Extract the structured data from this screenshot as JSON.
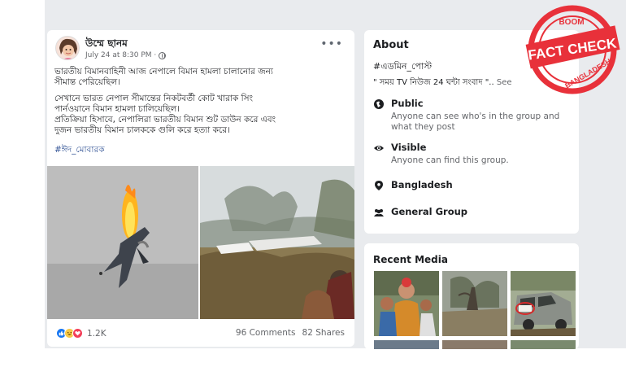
{
  "post": {
    "author": "উম্মে ছানম",
    "timestamp": "July 24 at 8:30 PM ·",
    "more_label": "•••",
    "text_lines": [
      "ভারতীয় বিমানবাহিনী আজ নেপালে বিমান হামলা চালানোর জন্য",
      "সীমান্ত পেরিয়েছিল।",
      "সেখানে ভারত নেপাল সীমান্তের নিকটবর্তী কোট খারাক সিং",
      "পার্নওয়ানে বিমান হামলা চালিয়েছিল।",
      "প্রতিক্রিয়া হিসাবে, নেপালিরা ভারতীয় বিমান শুট ডাউন করে এবং",
      "দুজন ভারতীয় বিমান চালককে গুলি করে হত্যা করে।"
    ],
    "hashtag": "#ঈদ_মোবারক",
    "reaction_count": "1.2K",
    "comments": "96 Comments",
    "shares": "82 Shares"
  },
  "about": {
    "title": "About",
    "tag": "#এডমিন_পোস্ট",
    "desc": "\" সময় TV নিউজ 24 ঘন্টা সংবাদ \"..",
    "see_more": "See",
    "privacy_title": "Public",
    "privacy_sub": "Anyone can see who's in the group and what they post",
    "visible_title": "Visible",
    "visible_sub": "Anyone can find this group.",
    "location": "Bangladesh",
    "group_type": "General Group"
  },
  "recent_media": {
    "title": "Recent Media"
  },
  "badge": {
    "brand": "BOOM",
    "headline": "FACT CHECK",
    "country": "BANGLADESH"
  },
  "icons": [
    "more-icon",
    "globe-icon",
    "like-icon",
    "haha-icon",
    "love-icon",
    "lock-icon",
    "eye-icon",
    "location-icon",
    "group-icon"
  ],
  "colors": {
    "background": "#e9ebee",
    "link": "#385898",
    "badge_red": "#e8313a"
  }
}
